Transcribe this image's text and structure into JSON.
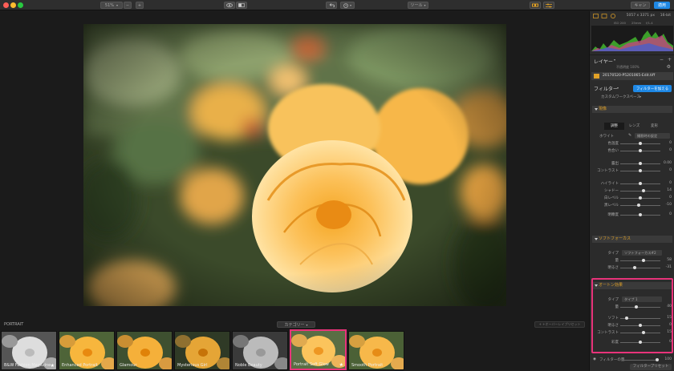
{
  "toolbar": {
    "zoom": "51%",
    "zoom_minus": "−",
    "zoom_plus": "+",
    "tools": "ツール",
    "cancel": "キャン",
    "apply": "適用"
  },
  "info": {
    "dims": "5057 x 3371 px",
    "bit": "16-bit",
    "iso": "ISO 200",
    "focal": "25mm",
    "aperture": "f/1.4"
  },
  "layers": {
    "title": "レイヤー",
    "opacity_label": "不透明度 100%",
    "file": "20170520-P5201065-Edit.tiff"
  },
  "filters": {
    "title": "フィルター",
    "add_button": "フィルターを加える",
    "workspace": "カスタムワークスペース"
  },
  "develop": {
    "title": "現像",
    "tabs": [
      "調整",
      "レンズ",
      "変形"
    ],
    "white_label": "ホワイト",
    "white_value": "撮影時の設定",
    "rows": [
      {
        "label": "色温度",
        "value": "0",
        "pos": 0.5
      },
      {
        "label": "色合い",
        "value": "0",
        "pos": 0.5
      },
      {
        "label": "露出",
        "value": "0.00",
        "pos": 0.5
      },
      {
        "label": "コントラスト",
        "value": "0",
        "pos": 0.5
      },
      {
        "label": "ハイライト",
        "value": "0",
        "pos": 0.5
      },
      {
        "label": "シャドー",
        "value": "14",
        "pos": 0.57
      },
      {
        "label": "白レベル",
        "value": "0",
        "pos": 0.5
      },
      {
        "label": "黒レベル",
        "value": "-10",
        "pos": 0.45
      },
      {
        "label": "明瞭度",
        "value": "0",
        "pos": 0.5
      }
    ]
  },
  "soft": {
    "title": "ソフトフォーカス",
    "type_label": "タイプ",
    "type_value": "ソフトフォーカス#2",
    "rows": [
      {
        "label": "量",
        "value": "58",
        "pos": 0.58
      },
      {
        "label": "明るさ",
        "value": "-31",
        "pos": 0.35
      }
    ]
  },
  "orton": {
    "title": "オートン効果",
    "type_label": "タイプ",
    "type_value": "タイプ 1",
    "rows": [
      {
        "label": "量",
        "value": "40",
        "pos": 0.4
      },
      {
        "label": "ソフト",
        "value": "15",
        "pos": 0.15
      },
      {
        "label": "明るさ",
        "value": "0",
        "pos": 0.5
      },
      {
        "label": "コントラスト",
        "value": "15",
        "pos": 0.57
      },
      {
        "label": "彩度",
        "value": "0",
        "pos": 0.5
      }
    ]
  },
  "footer": {
    "filter_amount": "フィルターの量",
    "filter_value": "100",
    "preset_button": "フィルタープリセット"
  },
  "presets": {
    "category": "PORTRAIT",
    "category_menu": "カテゴリー",
    "reset": "+ +オーバーレイプリセット",
    "items": [
      "B&W Fashion Magazine",
      "Enhanced Portrait",
      "Glamour",
      "Mysterious Girl",
      "Noble Beauty",
      "Portrait Soft Glow",
      "Smooth Portrait"
    ],
    "selected": 5
  },
  "colors": {
    "accent": "#e2a227",
    "apply": "#1e88e5",
    "highlight": "#e8337a"
  }
}
